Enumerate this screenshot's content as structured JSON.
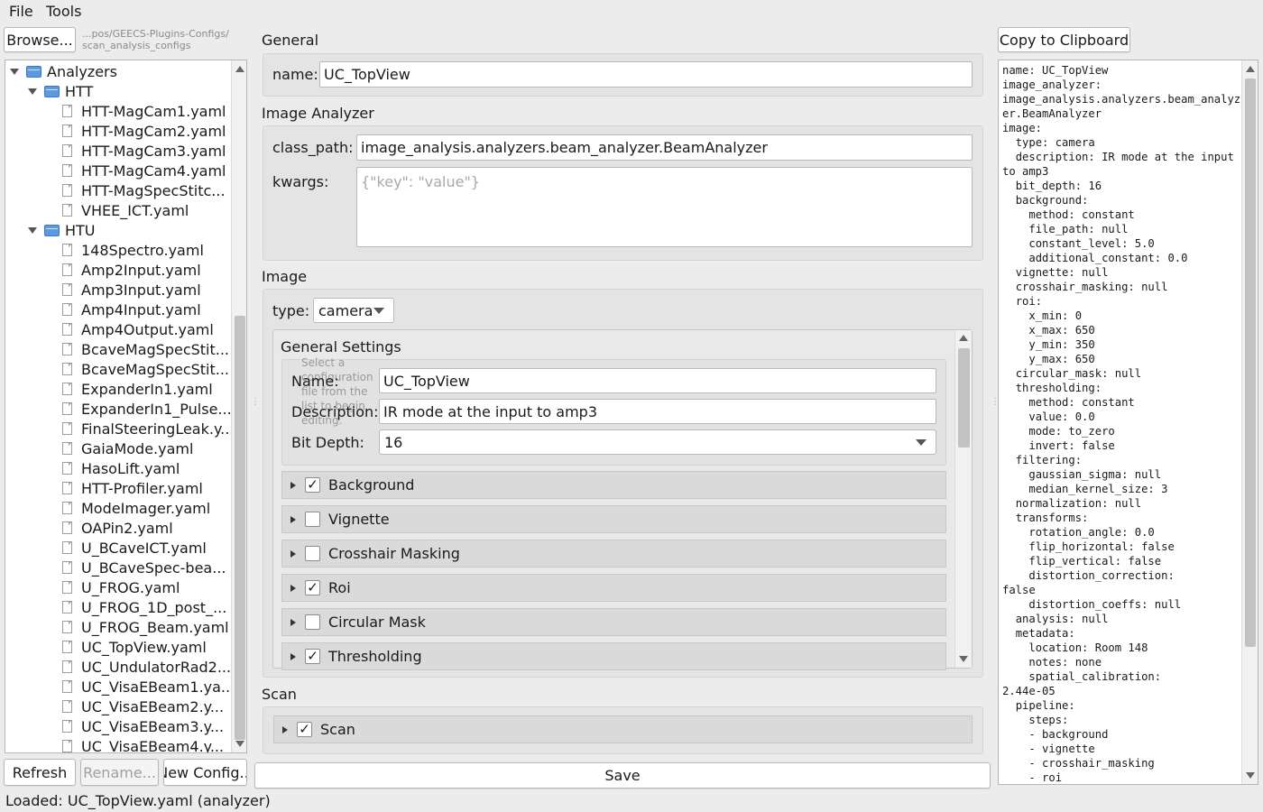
{
  "menu": {
    "file": "File",
    "tools": "Tools"
  },
  "browser": {
    "browse_label": "Browse...",
    "path": "...pos/GEECS-Plugins-Configs/ scan_analysis_configs",
    "tree": {
      "root": "Analyzers",
      "groups": [
        {
          "name": "HTT",
          "files": [
            "HTT-MagCam1.yaml",
            "HTT-MagCam2.yaml",
            "HTT-MagCam3.yaml",
            "HTT-MagCam4.yaml",
            "HTT-MagSpecStitc...",
            "VHEE_ICT.yaml"
          ]
        },
        {
          "name": "HTU",
          "files": [
            "148Spectro.yaml",
            "Amp2Input.yaml",
            "Amp3Input.yaml",
            "Amp4Input.yaml",
            "Amp4Output.yaml",
            "BcaveMagSpecStit...",
            "BcaveMagSpecStit...",
            "ExpanderIn1.yaml",
            "ExpanderIn1_Pulse...",
            "FinalSteeringLeak.y...",
            "GaiaMode.yaml",
            "HasoLift.yaml",
            "HTT-Profiler.yaml",
            "ModeImager.yaml",
            "OAPin2.yaml",
            "U_BCaveICT.yaml",
            "U_BCaveSpec-bea...",
            "U_FROG.yaml",
            "U_FROG_1D_post_...",
            "U_FROG_Beam.yaml",
            "UC_TopView.yaml",
            "UC_UndulatorRad2...",
            "UC_VisaEBeam1.ya...",
            "UC_VisaEBeam2.y...",
            "UC_VisaEBeam3.y...",
            "UC_VisaEBeam4.y..."
          ]
        }
      ]
    },
    "refresh_label": "Refresh",
    "rename_label": "Rename...",
    "new_config_label": "New Config..."
  },
  "general": {
    "title": "General",
    "name_label": "name:",
    "name_value": "UC_TopView"
  },
  "image_analyzer": {
    "title": "Image Analyzer",
    "class_path_label": "class_path:",
    "class_path_value": "image_analysis.analyzers.beam_analyzer.BeamAnalyzer",
    "kwargs_label": "kwargs:",
    "kwargs_placeholder": "{\"key\": \"value\"}"
  },
  "image": {
    "title": "Image",
    "type_label": "type:",
    "type_value": "camera",
    "general_settings": {
      "title": "General Settings",
      "name_label": "Name:",
      "name_value": "UC_TopView",
      "description_label": "Description:",
      "description_value": "IR mode at the input to amp3",
      "bit_depth_label": "Bit Depth:",
      "bit_depth_value": "16",
      "hint": "Select a configuration file from the list to begin editing."
    },
    "sections": [
      {
        "label": "Background",
        "checked": true
      },
      {
        "label": "Vignette",
        "checked": false
      },
      {
        "label": "Crosshair Masking",
        "checked": false
      },
      {
        "label": "Roi",
        "checked": true
      },
      {
        "label": "Circular Mask",
        "checked": false
      },
      {
        "label": "Thresholding",
        "checked": true
      }
    ]
  },
  "scan": {
    "title": "Scan",
    "section_label": "Scan",
    "checked": true
  },
  "save_label": "Save",
  "copy_label": "Copy to Clipboard",
  "yaml_preview": "name: UC_TopView\nimage_analyzer:\nimage_analysis.analyzers.beam_analyzer.BeamAnalyzer\nimage:\n  type: camera\n  description: IR mode at the input to amp3\n  bit_depth: 16\n  background:\n    method: constant\n    file_path: null\n    constant_level: 5.0\n    additional_constant: 0.0\n  vignette: null\n  crosshair_masking: null\n  roi:\n    x_min: 0\n    x_max: 650\n    y_min: 350\n    y_max: 650\n  circular_mask: null\n  thresholding:\n    method: constant\n    value: 0.0\n    mode: to_zero\n    invert: false\n  filtering:\n    gaussian_sigma: null\n    median_kernel_size: 3\n  normalization: null\n  transforms:\n    rotation_angle: 0.0\n    flip_horizontal: false\n    flip_vertical: false\n    distortion_correction:\nfalse\n    distortion_coeffs: null\n  analysis: null\n  metadata:\n    location: Room 148\n    notes: none\n    spatial_calibration:\n2.44e-05\n  pipeline:\n    steps:\n    - background\n    - vignette\n    - crosshair_masking\n    - roi",
  "status": "Loaded: UC_TopView.yaml (analyzer)"
}
